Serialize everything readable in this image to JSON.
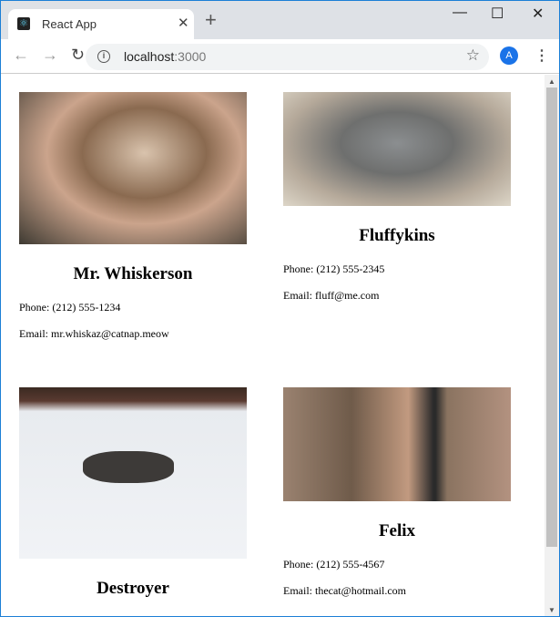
{
  "browser": {
    "tab_title": "React App",
    "url_host": "localhost",
    "url_port": ":3000",
    "avatar_letter": "A"
  },
  "cats": [
    {
      "name": "Mr. Whiskerson",
      "phone": "Phone: (212) 555-1234",
      "email": "Email: mr.whiskaz@catnap.meow"
    },
    {
      "name": "Fluffykins",
      "phone": "Phone: (212) 555-2345",
      "email": "Email: fluff@me.com"
    },
    {
      "name": "Destroyer"
    },
    {
      "name": "Felix",
      "phone": "Phone: (212) 555-4567",
      "email": "Email: thecat@hotmail.com"
    }
  ]
}
